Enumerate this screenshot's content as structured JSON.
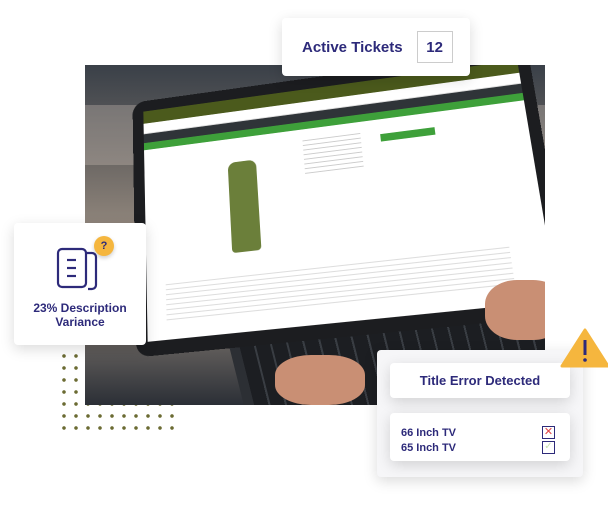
{
  "tickets": {
    "label": "Active Tickets",
    "count": "12"
  },
  "variance": {
    "text": "23% Description Variance",
    "icon": "document-icon",
    "badge": "?"
  },
  "title_error": {
    "heading": "Title Error Detected",
    "badge": "!",
    "items": [
      {
        "label": "66 Inch TV",
        "status": "rejected"
      },
      {
        "label": "65 Inch TV",
        "status": "accepted"
      }
    ]
  },
  "colors": {
    "navy": "#2d2a7a",
    "warning": "#f5b63e",
    "reject": "#e04444",
    "accept": "#8cc46a",
    "site_green": "#3ea03a"
  }
}
